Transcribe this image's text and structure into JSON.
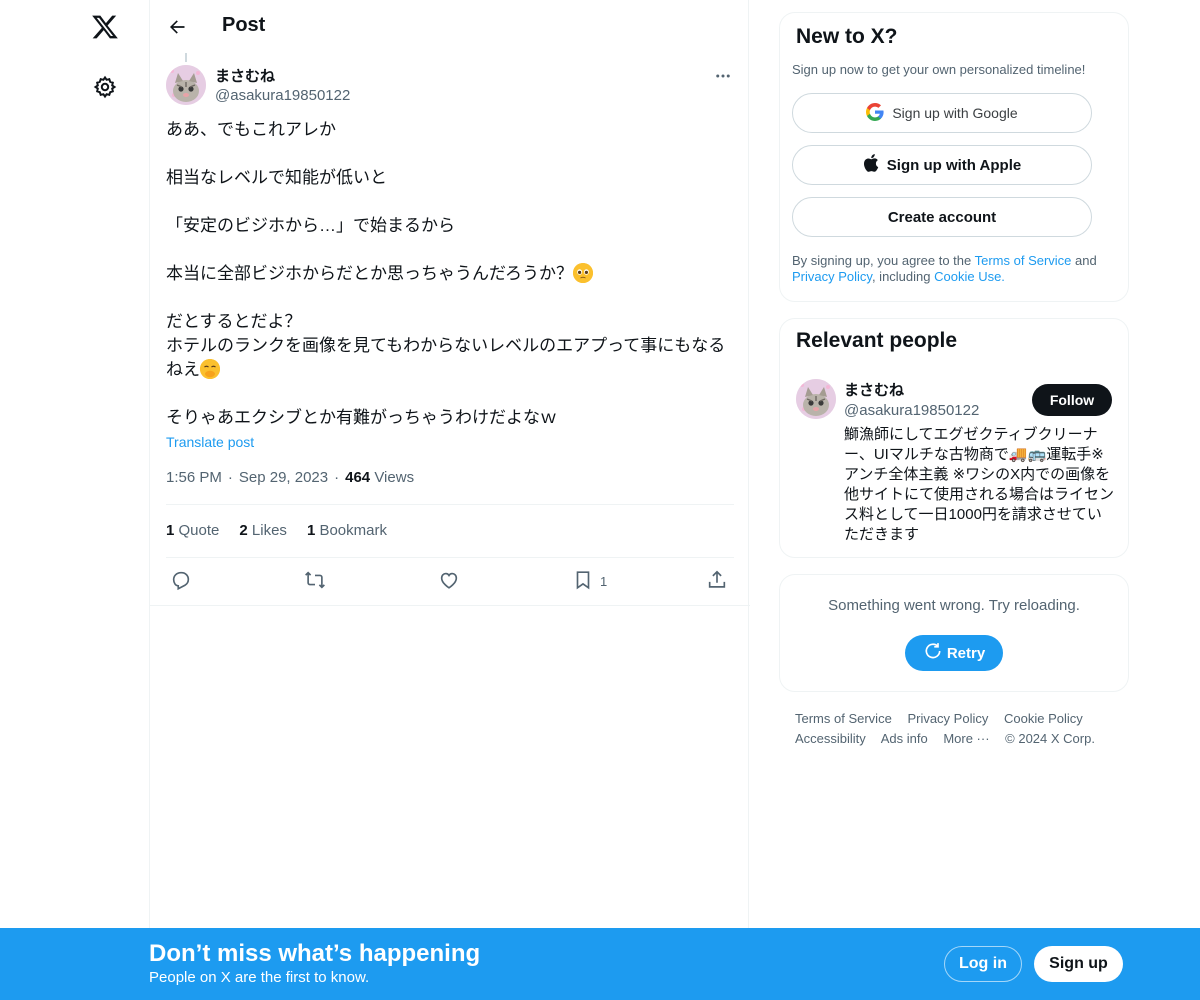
{
  "nav": {
    "logo_icon": "x-logo-icon",
    "settings_icon": "gear-icon"
  },
  "header": {
    "title": "Post",
    "back_icon": "arrow-left-icon"
  },
  "post": {
    "author_name": "まさむね",
    "author_handle": "@asakura19850122",
    "body": [
      "ああ、でもこれアレか",
      "",
      "相当なレベルで知能が低いと",
      "",
      "「安定のビジホから…」で始まるから",
      "",
      "本当に全部ビジホからだとか思っちゃうんだろうか？",
      "",
      "だとするとだよ？",
      "ホテルのランクを画像を見てもわからないレベルのエアプって事にもなるねえ",
      "",
      "そりゃあエクシブとか有難がっちゃうわけだよなｗ"
    ],
    "translate_label": "Translate post",
    "time": "1:56 PM",
    "date": "Sep 29, 2023",
    "views_count": "464",
    "views_label": "Views",
    "stats": {
      "quote_count": "1",
      "quote_label": "Quote",
      "likes_count": "2",
      "likes_label": "Likes",
      "bookmark_count": "1",
      "bookmark_label": "Bookmark"
    },
    "actions": {
      "bookmark_count": "1"
    }
  },
  "new_to_x": {
    "title": "New to X?",
    "subtitle": "Sign up now to get your own personalized timeline!",
    "google_label": "Sign up with Google",
    "apple_label": "Sign up with Apple",
    "create_label": "Create account",
    "legal_prefix": "By signing up, you agree to the ",
    "terms_link": "Terms of Service",
    "legal_and": " and ",
    "privacy_link": "Privacy Policy",
    "legal_including": ", including ",
    "cookie_link": "Cookie Use."
  },
  "relevant": {
    "title": "Relevant people",
    "name": "まさむね",
    "handle": "@asakura19850122",
    "follow_label": "Follow",
    "bio": "鰤漁師にしてエグゼクティブクリーナー、UIマルチな古物商で🚚🚌運転手※アンチ全体主義 ※ワシのX内での画像を他サイトにて使用される場合はライセンス料として一日1000円を請求させていただきます"
  },
  "error_card": {
    "text": "Something went wrong. Try reloading.",
    "retry_label": "Retry"
  },
  "footer": {
    "links": [
      "Terms of Service",
      "Privacy Policy",
      "Cookie Policy",
      "Accessibility",
      "Ads info",
      "More ···",
      "© 2024 X Corp."
    ]
  },
  "bottom_bar": {
    "title": "Don’t miss what’s happening",
    "subtitle": "People on X are the first to know.",
    "login_label": "Log in",
    "signup_label": "Sign up"
  },
  "colors": {
    "accent": "#1d9bf0",
    "text": "#0f1419",
    "muted": "#536471"
  }
}
